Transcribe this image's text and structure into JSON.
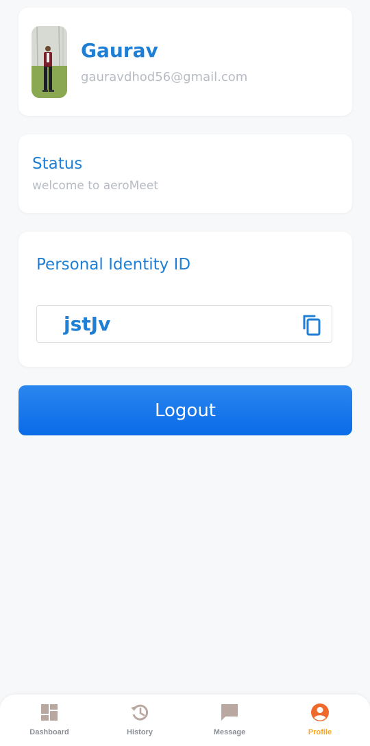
{
  "profile": {
    "name": "Gaurav",
    "email": "gauravdhod56@gmail.com",
    "avatar_icon": "user-photo"
  },
  "status": {
    "title": "Status",
    "text": "welcome to aeroMeet"
  },
  "identity": {
    "title": "Personal Identity ID",
    "value": "jstJv",
    "copy_icon": "copy-icon"
  },
  "actions": {
    "logout_label": "Logout"
  },
  "nav": {
    "items": [
      {
        "label": "Dashboard",
        "icon": "dashboard-icon",
        "active": false
      },
      {
        "label": "History",
        "icon": "history-icon",
        "active": false
      },
      {
        "label": "Message",
        "icon": "message-icon",
        "active": false
      },
      {
        "label": "Profile",
        "icon": "profile-icon",
        "active": true
      }
    ]
  },
  "colors": {
    "accent": "#1e7fd4",
    "button": "#1a78ec",
    "muted": "#b7bcc4",
    "nav_inactive_icon": "#b9a8a0",
    "nav_active_icon": "#ee6a2c",
    "nav_active_label": "#f5a623"
  }
}
